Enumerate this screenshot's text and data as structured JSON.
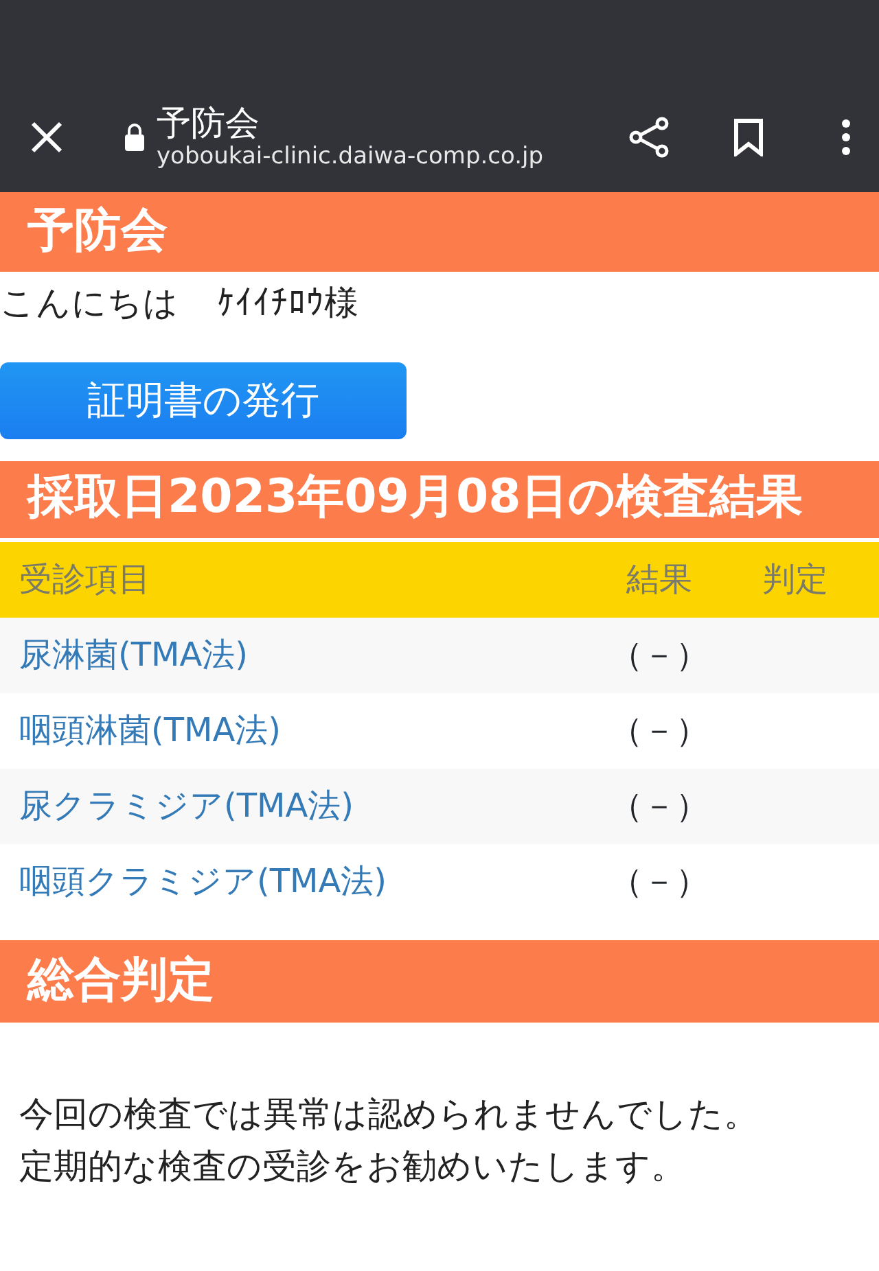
{
  "browser": {
    "page_title": "予防会",
    "url": "yoboukai-clinic.daiwa-comp.co.jp"
  },
  "site_title": "予防会",
  "greeting": {
    "text": "こんにちは",
    "name": "ｹｲｲﾁﾛｳ様"
  },
  "certificate_button": "証明書の発行",
  "results_heading": "採取日2023年09月08日の検査結果",
  "table": {
    "columns": [
      "受診項目",
      "結果",
      "判定"
    ],
    "rows": [
      {
        "item": "尿淋菌(TMA法)",
        "result": "（－）"
      },
      {
        "item": "咽頭淋菌(TMA法)",
        "result": "（－）"
      },
      {
        "item": "尿クラミジア(TMA法)",
        "result": "（－）"
      },
      {
        "item": "咽頭クラミジア(TMA法)",
        "result": "（－）"
      }
    ]
  },
  "summary_heading": "総合判定",
  "summary_text": [
    "今回の検査では異常は認められませんでした。",
    "定期的な検査の受診をお勧めいたします。"
  ]
}
